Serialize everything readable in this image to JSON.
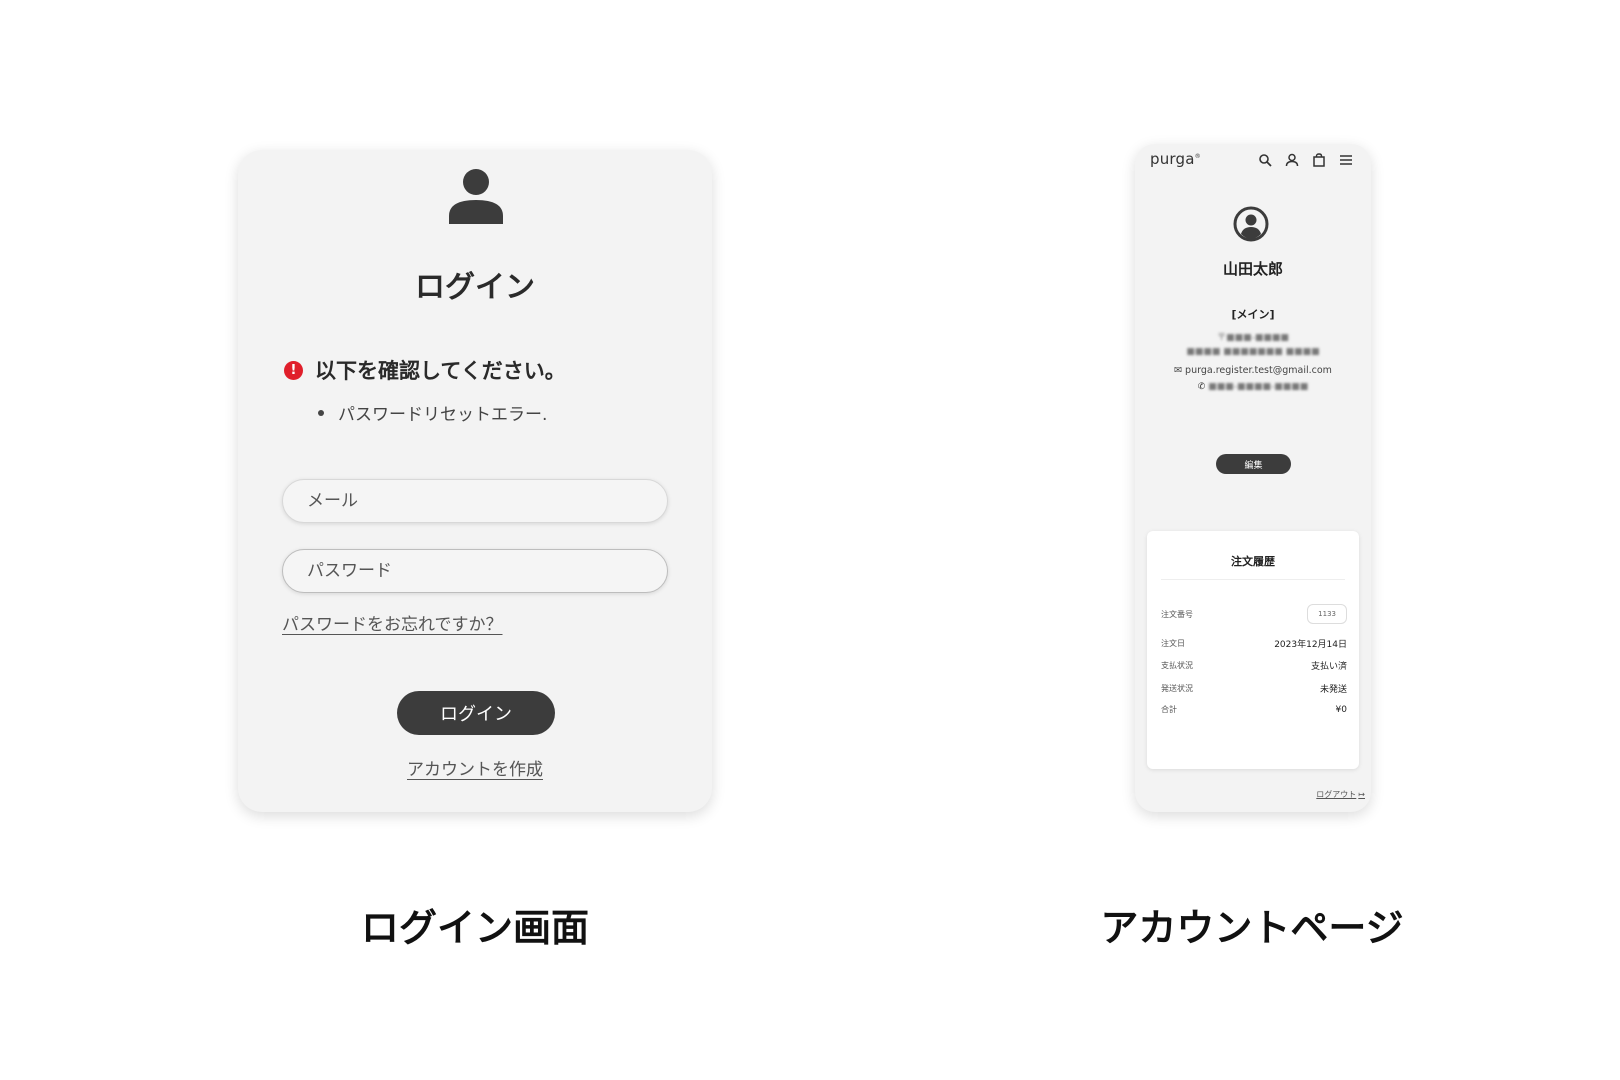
{
  "login": {
    "title": "ログイン",
    "error_title": "以下を確認してください。",
    "error_item": "パスワードリセットエラー.",
    "email_placeholder": "メール",
    "password_placeholder": "パスワード",
    "forgot_link": "パスワードをお忘れですか？",
    "login_button": "ログイン",
    "create_account_link": "アカウントを作成",
    "error_color": "#e01e2a",
    "button_color": "#3c3c3c"
  },
  "account": {
    "logo": "purga",
    "name": "山田太郎",
    "address_label": "[メイン]",
    "email": "purga.register.test@gmail.com",
    "edit_button": "編集",
    "order_history": {
      "title": "注文履歴",
      "rows": [
        {
          "label": "注文番号",
          "value": "1133"
        },
        {
          "label": "注文日",
          "value": "2023年12月14日"
        },
        {
          "label": "支払状況",
          "value": "支払い済"
        },
        {
          "label": "発送状況",
          "value": "未発送"
        },
        {
          "label": "合計",
          "value": "¥0"
        }
      ]
    },
    "logout_link": "ログアウト"
  },
  "captions": {
    "left": "ログイン画面",
    "right": "アカウントページ"
  }
}
